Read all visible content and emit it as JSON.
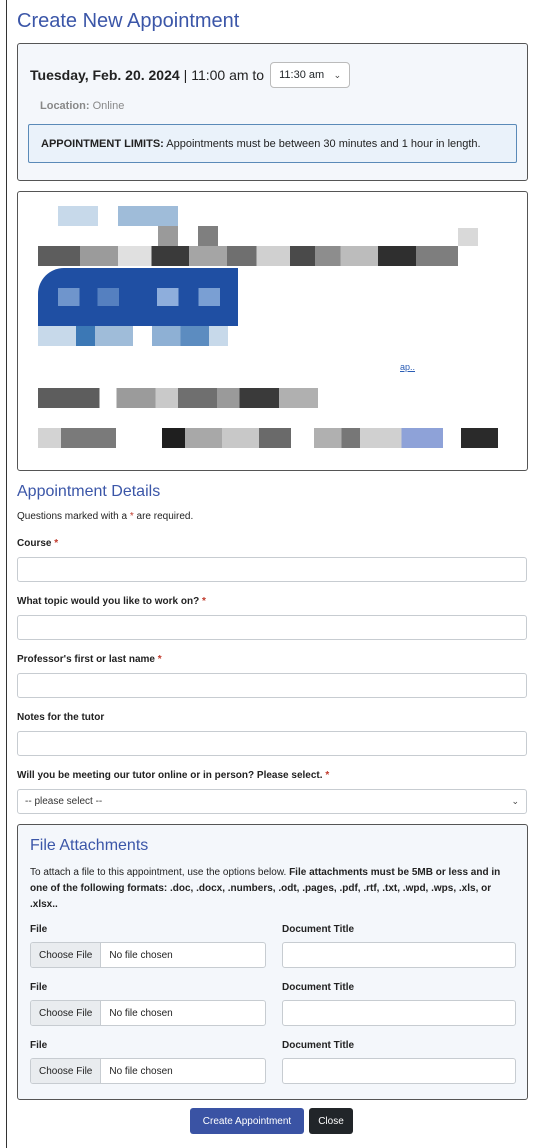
{
  "header": {
    "title": "Create New Appointment"
  },
  "appointment": {
    "date": "Tuesday, Feb. 20. 2024",
    "time_range": "| 11:00 am to",
    "end_time_selected": "11:30 am",
    "location_label": "Location:",
    "location_value": "Online",
    "limits_label": "APPOINTMENT LIMITS:",
    "limits_text": "Appointments must be between 30 minutes and 1 hour in length."
  },
  "info_panel": {
    "link_text": "ap.."
  },
  "details": {
    "title": "Appointment Details",
    "required_note_prefix": "Questions marked with a",
    "required_star": "*",
    "required_note_suffix": "are required.",
    "fields": [
      {
        "label": "Course",
        "required": "*"
      },
      {
        "label": "What topic would you like to work on?",
        "required": "*"
      },
      {
        "label": "Professor's first or last name",
        "required": "*"
      },
      {
        "label": "Notes for the tutor",
        "required": ""
      },
      {
        "label": "Will you be meeting our tutor online or in person? Please select.",
        "required": "*"
      }
    ],
    "meeting_select_value": "-- please select --"
  },
  "attachments": {
    "title": "File Attachments",
    "desc_plain": "To attach a file to this appointment, use the options below.",
    "desc_bold": "File attachments must be 5MB or less and in one of the following formats: .doc, .docx, .numbers, .odt, .pages, .pdf, .rtf, .txt, .wpd, .wps, .xls, or .xlsx..",
    "file_label": "File",
    "doc_title_label": "Document Title",
    "choose_file": "Choose File",
    "no_file": "No file chosen"
  },
  "actions": {
    "create_label": "Create Appointment",
    "close_label": "Close"
  },
  "colors": {
    "accent": "#3b56a8",
    "primary_button": "#3a53a4",
    "dark_button": "#212529",
    "required": "#c0392b"
  }
}
